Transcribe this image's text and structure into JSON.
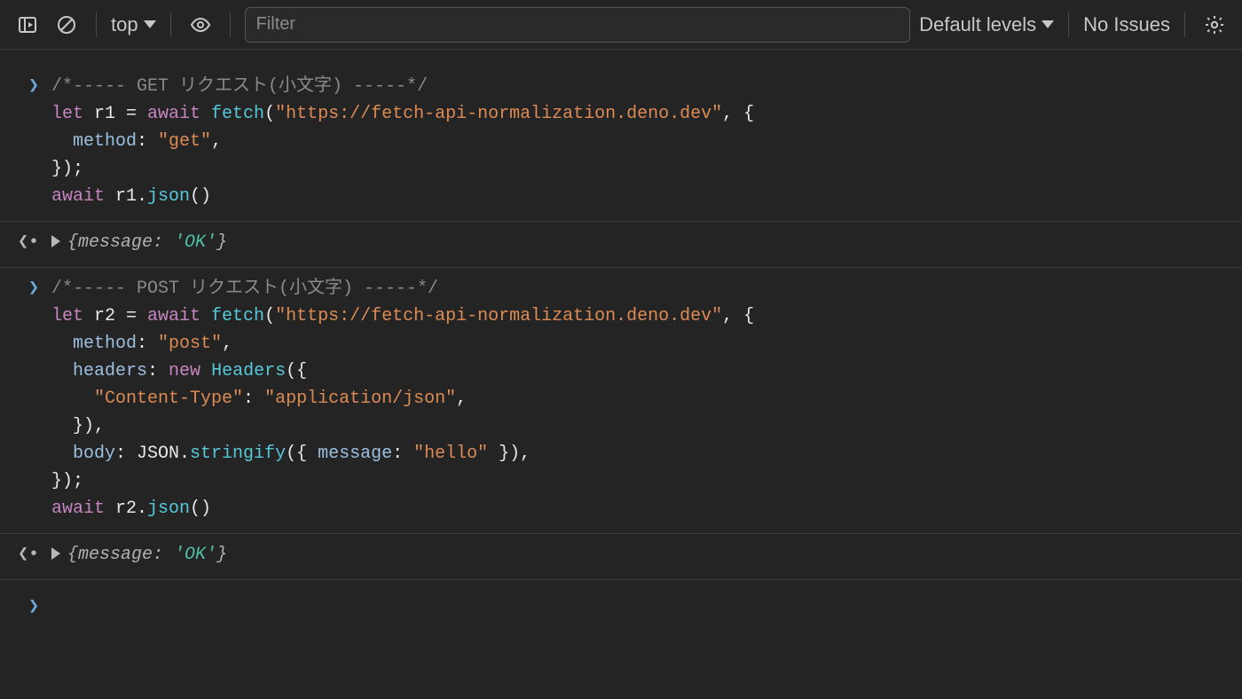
{
  "toolbar": {
    "context_label": "top",
    "filter_placeholder": "Filter",
    "levels_label": "Default levels",
    "issues_label": "No Issues"
  },
  "icons": {
    "sidebar": "toggle-sidebar-icon",
    "clear": "clear-console-icon",
    "eye": "live-expression-icon",
    "gear": "settings-icon"
  },
  "console": {
    "entries": [
      {
        "kind": "input",
        "code": {
          "lines": [
            [
              {
                "t": "/*----- GET リクエスト(小文字) -----*/",
                "c": "cmt"
              }
            ],
            [
              {
                "t": "let ",
                "c": "kw"
              },
              {
                "t": "r1 = ",
                "c": "id"
              },
              {
                "t": "await ",
                "c": "kw"
              },
              {
                "t": "fetch",
                "c": "fn"
              },
              {
                "t": "(",
                "c": "punc"
              },
              {
                "t": "\"https://fetch-api-normalization.deno.dev\"",
                "c": "str"
              },
              {
                "t": ", {",
                "c": "punc"
              }
            ],
            [
              {
                "t": "  ",
                "c": "punc"
              },
              {
                "t": "method",
                "c": "prop"
              },
              {
                "t": ": ",
                "c": "punc"
              },
              {
                "t": "\"get\"",
                "c": "str"
              },
              {
                "t": ",",
                "c": "punc"
              }
            ],
            [
              {
                "t": "});",
                "c": "punc"
              }
            ],
            [
              {
                "t": "await ",
                "c": "kw"
              },
              {
                "t": "r1.",
                "c": "id"
              },
              {
                "t": "json",
                "c": "fn"
              },
              {
                "t": "()",
                "c": "punc"
              }
            ]
          ]
        }
      },
      {
        "kind": "output",
        "preview": {
          "key": "message",
          "value": "'OK'"
        }
      },
      {
        "kind": "input",
        "code": {
          "lines": [
            [
              {
                "t": "/*----- POST リクエスト(小文字) -----*/",
                "c": "cmt"
              }
            ],
            [
              {
                "t": "let ",
                "c": "kw"
              },
              {
                "t": "r2 = ",
                "c": "id"
              },
              {
                "t": "await ",
                "c": "kw"
              },
              {
                "t": "fetch",
                "c": "fn"
              },
              {
                "t": "(",
                "c": "punc"
              },
              {
                "t": "\"https://fetch-api-normalization.deno.dev\"",
                "c": "str"
              },
              {
                "t": ", {",
                "c": "punc"
              }
            ],
            [
              {
                "t": "  ",
                "c": "punc"
              },
              {
                "t": "method",
                "c": "prop"
              },
              {
                "t": ": ",
                "c": "punc"
              },
              {
                "t": "\"post\"",
                "c": "str"
              },
              {
                "t": ",",
                "c": "punc"
              }
            ],
            [
              {
                "t": "  ",
                "c": "punc"
              },
              {
                "t": "headers",
                "c": "prop"
              },
              {
                "t": ": ",
                "c": "punc"
              },
              {
                "t": "new ",
                "c": "kw"
              },
              {
                "t": "Headers",
                "c": "fn"
              },
              {
                "t": "({",
                "c": "punc"
              }
            ],
            [
              {
                "t": "    ",
                "c": "punc"
              },
              {
                "t": "\"Content-Type\"",
                "c": "str"
              },
              {
                "t": ": ",
                "c": "punc"
              },
              {
                "t": "\"application/json\"",
                "c": "str"
              },
              {
                "t": ",",
                "c": "punc"
              }
            ],
            [
              {
                "t": "  }),",
                "c": "punc"
              }
            ],
            [
              {
                "t": "  ",
                "c": "punc"
              },
              {
                "t": "body",
                "c": "prop"
              },
              {
                "t": ": JSON.",
                "c": "id"
              },
              {
                "t": "stringify",
                "c": "fn"
              },
              {
                "t": "({ ",
                "c": "punc"
              },
              {
                "t": "message",
                "c": "prop"
              },
              {
                "t": ": ",
                "c": "punc"
              },
              {
                "t": "\"hello\"",
                "c": "str"
              },
              {
                "t": " }),",
                "c": "punc"
              }
            ],
            [
              {
                "t": "});",
                "c": "punc"
              }
            ],
            [
              {
                "t": "await ",
                "c": "kw"
              },
              {
                "t": "r2.",
                "c": "id"
              },
              {
                "t": "json",
                "c": "fn"
              },
              {
                "t": "()",
                "c": "punc"
              }
            ]
          ]
        }
      },
      {
        "kind": "output",
        "preview": {
          "key": "message",
          "value": "'OK'"
        }
      }
    ],
    "prompt_marker": ">"
  }
}
